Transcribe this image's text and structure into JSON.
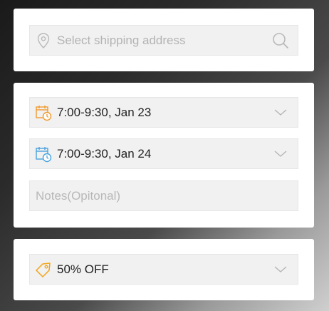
{
  "address": {
    "placeholder": "Select shipping address",
    "icon": "location-pin-icon",
    "action_icon": "search-icon"
  },
  "delivery": {
    "slot1": {
      "label": "7:00-9:30, Jan 23",
      "icon": "calendar-clock-icon",
      "icon_color": "#f29a2e"
    },
    "slot2": {
      "label": "7:00-9:30, Jan 24",
      "icon": "calendar-clock-icon",
      "icon_color": "#4aa3df"
    },
    "notes_placeholder": "Notes(Opitonal)"
  },
  "coupon": {
    "label": "50% OFF",
    "icon": "tag-icon",
    "icon_color": "#f2a51a"
  }
}
